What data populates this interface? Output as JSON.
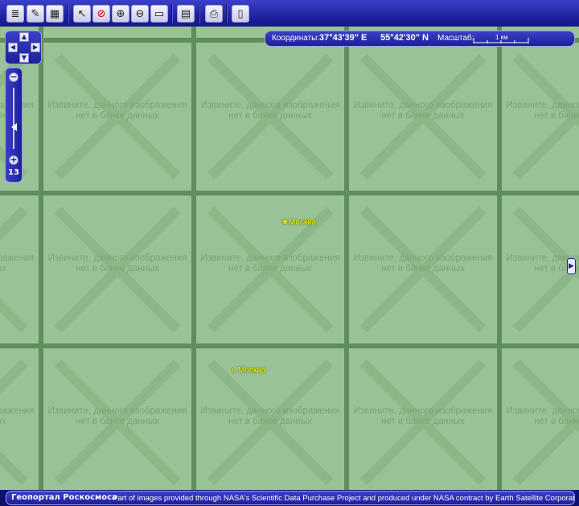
{
  "toolbar": {
    "buttons": [
      {
        "name": "layers-icon",
        "glyph": "≣"
      },
      {
        "name": "image-edit-icon",
        "glyph": "✎"
      },
      {
        "name": "satellite-image-icon",
        "glyph": "▦"
      },
      {
        "name": "pointer-icon",
        "glyph": "↖"
      },
      {
        "name": "no-entry-icon",
        "glyph": "⊘"
      },
      {
        "name": "zoom-in-icon",
        "glyph": "⊕"
      },
      {
        "name": "zoom-out-icon",
        "glyph": "⊖"
      },
      {
        "name": "zoom-area-icon",
        "glyph": "▭"
      },
      {
        "name": "ruler-icon",
        "glyph": "▤"
      },
      {
        "name": "print-icon",
        "glyph": "⎙"
      },
      {
        "name": "page-icon",
        "glyph": "▯"
      }
    ]
  },
  "coords": {
    "label": "Координаты:",
    "longitude": "37°43'39\" E",
    "latitude": "55°42'30\" N",
    "scale_label": "Масштаб:",
    "scale_value": "1 км"
  },
  "zoom": {
    "level": "13"
  },
  "tile_message": "Извините, данного изображения нет в банке данных",
  "labels": {
    "city1": "Москва",
    "city2": "г. Москва"
  },
  "bottom": {
    "brand": "Геопортал Роскосмоса",
    "credit": "Part of images provided through NASA's Scientific Data Purchase Project and produced under NASA contract by Earth Satellite Corporation"
  },
  "colors": {
    "toolbar": "#1d1f9a",
    "tile": "#99c296",
    "grid": "#5f8d5e",
    "label": "#ffff00"
  }
}
